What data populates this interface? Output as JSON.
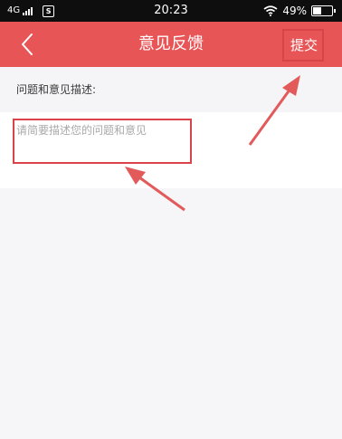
{
  "status_bar": {
    "network": "4G",
    "app_icon": "S",
    "time": "20:23",
    "wifi_icon": "wifi-icon",
    "battery": "49%"
  },
  "header": {
    "back_icon": "chevron-left-icon",
    "title": "意见反馈",
    "submit_label": "提交"
  },
  "form": {
    "label": "问题和意见描述:",
    "placeholder": "请简要描述您的问题和意见",
    "value": ""
  },
  "colors": {
    "header_bg": "#e85556",
    "highlight": "#d9434a"
  }
}
